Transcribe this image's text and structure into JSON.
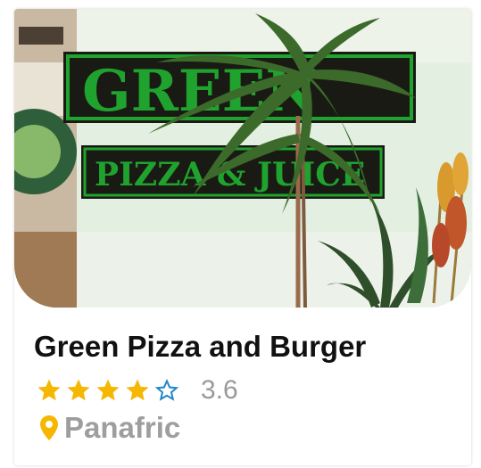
{
  "listing": {
    "name": "Green Pizza and Burger",
    "rating": 3.6,
    "rating_text": "3.6",
    "location": "Panafric",
    "photo": {
      "sign_line_1": "GREEN",
      "sign_line_2": "PIZZA & JUICE"
    }
  },
  "colors": {
    "star": "#f5b700",
    "star_empty": "#1e88c8",
    "pin": "#f5b700",
    "sign_green": "#1fa32e"
  },
  "icons": {
    "rating": "star-icon",
    "location": "location-pin-icon"
  }
}
